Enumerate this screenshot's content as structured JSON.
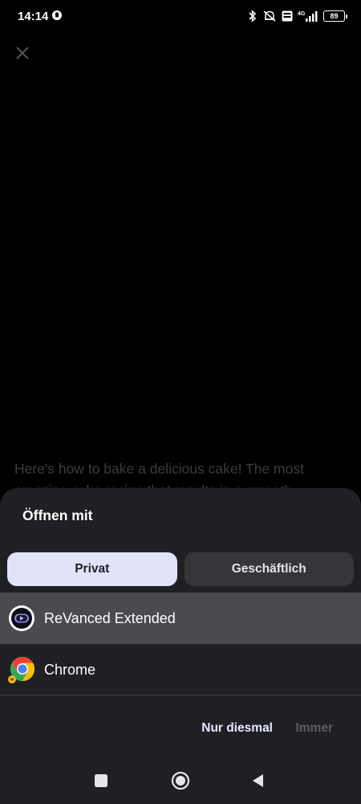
{
  "status_bar": {
    "time": "14:14",
    "battery": "89",
    "network": "4G",
    "icons": [
      "bluetooth-icon",
      "mute-icon",
      "volte-icon",
      "signal-icon",
      "battery-icon"
    ]
  },
  "background": {
    "close_icon": "close-icon",
    "text": "Here's how to bake a delicious cake! The most amazing cake recipe that results in a smooth"
  },
  "sheet": {
    "title": "Öffnen mit",
    "tabs": [
      {
        "label": "Privat",
        "active": true
      },
      {
        "label": "Geschäftlich",
        "active": false
      }
    ],
    "apps": [
      {
        "label": "ReVanced Extended",
        "icon": "revanced-icon",
        "selected": true
      },
      {
        "label": "Chrome",
        "icon": "chrome-icon",
        "selected": false
      }
    ],
    "actions": {
      "once": "Nur diesmal",
      "always": "Immer"
    }
  },
  "nav_bar": {
    "icons": [
      "recents-icon",
      "home-icon",
      "back-icon"
    ]
  },
  "colors": {
    "sheet_bg": "#1f2024",
    "tab_active_bg": "#e1e3fb",
    "tab_inactive_bg": "#35363b",
    "selected_row_bg": "#4a4b4f",
    "disabled_text": "#5b5c62"
  }
}
